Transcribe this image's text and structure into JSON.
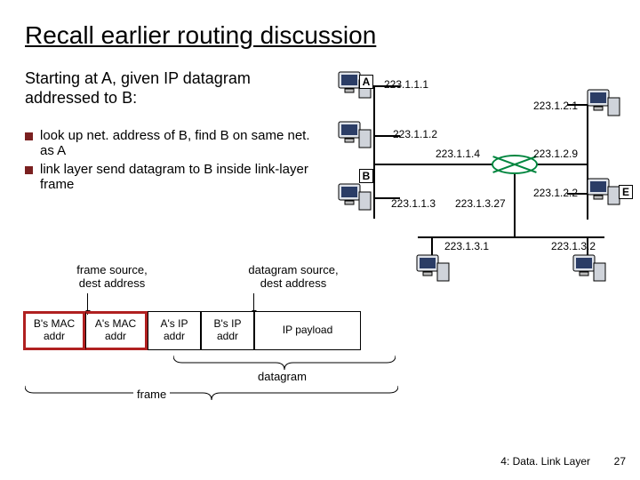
{
  "title": "Recall earlier routing discussion",
  "lead": "Starting at A, given IP datagram addressed to B:",
  "bullets": [
    "look up net. address of B, find B on same net. as A",
    "link layer send datagram to B inside link-layer frame"
  ],
  "captions": {
    "frame_addr": "frame source,\ndest address",
    "dgram_addr": "datagram source,\ndest address"
  },
  "cells": {
    "mac_dst": "B's MAC\naddr",
    "mac_src": "A's MAC\naddr",
    "ip_src": "A's IP\naddr",
    "ip_dst": "B's IP\naddr",
    "payload": "IP payload"
  },
  "braces": {
    "datagram": "datagram",
    "frame": "frame"
  },
  "hosts": {
    "A": "A",
    "B": "B",
    "E": "E"
  },
  "ips": {
    "a": "223.1.1.1",
    "mid": "223.1.1.2",
    "b": "223.1.1.3",
    "r1": "223.1.1.4",
    "r2": "223.1.2.9",
    "r3": "223.1.3.27",
    "e_top": "223.1.2.1",
    "e": "223.1.2.2",
    "d_l": "223.1.3.1",
    "d_r": "223.1.3.2"
  },
  "footer": {
    "chapter": "4: Data. Link Layer",
    "page": "27"
  }
}
